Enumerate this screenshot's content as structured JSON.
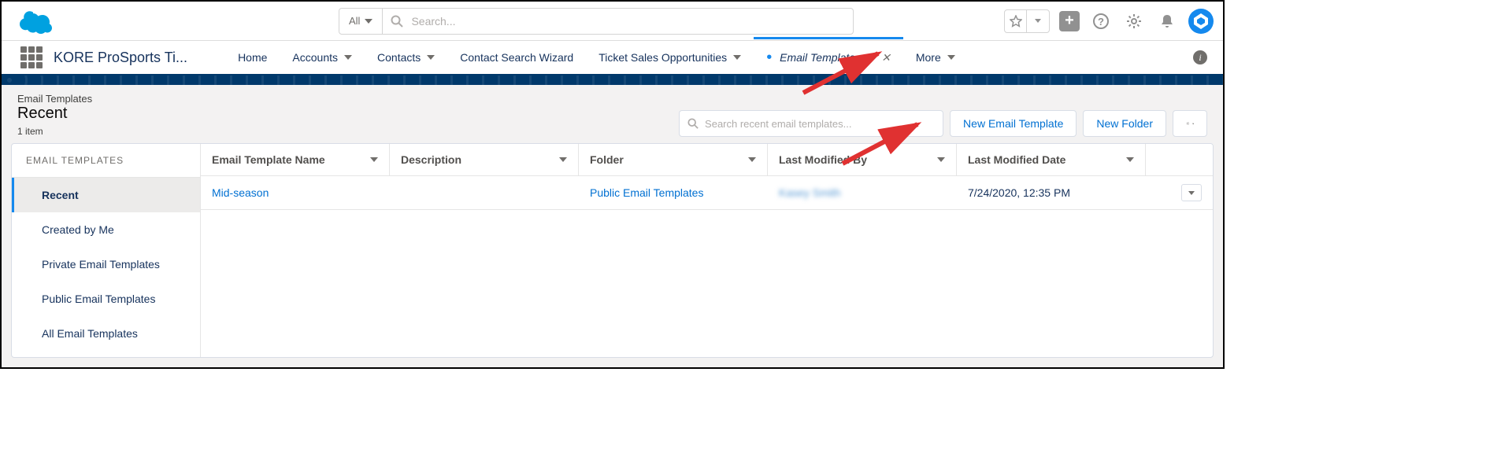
{
  "header": {
    "search_scope": "All",
    "search_placeholder": "Search..."
  },
  "nav": {
    "app_name": "KORE ProSports Ti...",
    "tabs": [
      {
        "label": "Home",
        "dropdown": false
      },
      {
        "label": "Accounts",
        "dropdown": true
      },
      {
        "label": "Contacts",
        "dropdown": true
      },
      {
        "label": "Contact Search Wizard",
        "dropdown": false
      },
      {
        "label": "Ticket Sales Opportunities",
        "dropdown": true
      },
      {
        "label": "Email Templates",
        "dropdown": true,
        "active": true,
        "closable": true,
        "unsaved": true
      },
      {
        "label": "More",
        "dropdown": true
      }
    ]
  },
  "page": {
    "object_label": "Email Templates",
    "view_name": "Recent",
    "item_count": "1 item",
    "filter_placeholder": "Search recent email templates...",
    "new_template_btn": "New Email Template",
    "new_folder_btn": "New Folder"
  },
  "sidebar": {
    "heading": "EMAIL TEMPLATES",
    "items": [
      "Recent",
      "Created by Me",
      "Private Email Templates",
      "Public Email Templates",
      "All Email Templates"
    ]
  },
  "table": {
    "columns": [
      "Email Template Name",
      "Description",
      "Folder",
      "Last Modified By",
      "Last Modified Date"
    ],
    "rows": [
      {
        "name": "Mid-season",
        "description": "",
        "folder": "Public Email Templates",
        "modified_by": "Kasey Smith",
        "modified_date": "7/24/2020, 12:35 PM"
      }
    ]
  }
}
